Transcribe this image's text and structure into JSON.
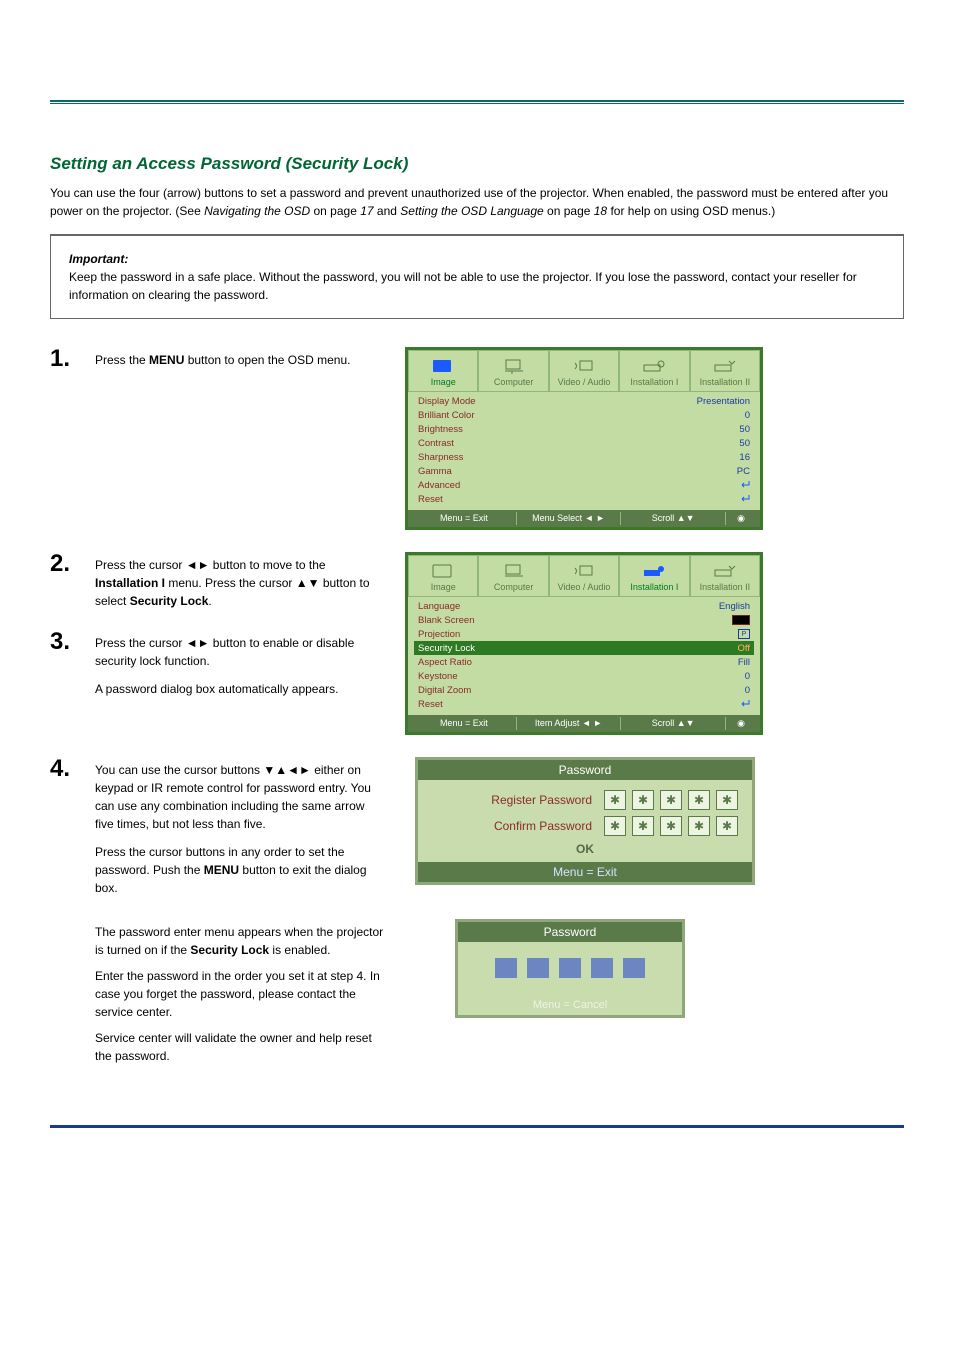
{
  "section_title": "Setting an Access Password (Security Lock)",
  "lead": {
    "p1": "You can use the four (arrow) buttons to set a password and prevent unauthorized use of the projector. When enabled, the password must be entered after you power on the projector. (See ",
    "ref1": "Navigating the OSD",
    "p2": " on page ",
    "page1": "17",
    "p3": " and ",
    "ref2": "Setting the OSD Language",
    "p4": " on page ",
    "page2": "18",
    "p5": " for help on using OSD menus.)"
  },
  "note": {
    "head": "Important:",
    "body": "Keep the password in a safe place. Without the password, you will not be able to use the projector. If you lose the password, contact your reseller for information on clearing the password."
  },
  "steps": {
    "s1": {
      "num": "1.",
      "text_a": "Press the ",
      "text_b": " button to open the OSD menu.",
      "key": "MENU"
    },
    "s2": {
      "num": "2.",
      "text_a": "Press the cursor ",
      "text_b": " button to move to the ",
      "text_c": " menu. Press the cursor ",
      "text_d": " button to select ",
      "key1": "◄►",
      "menu": "Installation I",
      "key2": "▲▼",
      "item": "Security Lock"
    },
    "s3": {
      "num": "3.",
      "text_a": "Press the cursor ",
      "text_b": " button to enable or disable security lock function.",
      "key": "◄►",
      "text_c": "A password dialog box automatically appears."
    },
    "s4": {
      "num": "4.",
      "text_a": "You can use the cursor buttons ",
      "key": "▼▲◄►",
      "text_b": " either on keypad or IR remote control for password entry. You can use any combination including the same arrow five times, but not less than five.",
      "text_c": "Press the cursor buttons in any order to set the password. Push the ",
      "key2": "MENU",
      "text_d": " button to exit the dialog box."
    }
  },
  "osd1": {
    "tabs": {
      "image": "Image",
      "computer": "Computer",
      "video": "Video / Audio",
      "inst1": "Installation I",
      "inst2": "Installation II"
    },
    "rows": {
      "display_mode": {
        "label": "Display Mode",
        "val": "Presentation"
      },
      "brilliant_color": {
        "label": "Brilliant Color",
        "val": "0"
      },
      "brightness": {
        "label": "Brightness",
        "val": "50"
      },
      "contrast": {
        "label": "Contrast",
        "val": "50"
      },
      "sharpness": {
        "label": "Sharpness",
        "val": "16"
      },
      "gamma": {
        "label": "Gamma",
        "val": "PC"
      },
      "advanced": {
        "label": "Advanced"
      },
      "reset": {
        "label": "Reset"
      }
    },
    "foot": {
      "exit": "Menu = Exit",
      "select": "Menu Select ◄ ►",
      "scroll": "Scroll ▲▼"
    }
  },
  "osd2": {
    "tabs": {
      "image": "Image",
      "computer": "Computer",
      "video": "Video / Audio",
      "inst1": "Installation I",
      "inst2": "Installation II"
    },
    "rows": {
      "language": {
        "label": "Language",
        "val": "English"
      },
      "blank_screen": {
        "label": "Blank Screen"
      },
      "projection": {
        "label": "Projection",
        "val": "P"
      },
      "security_lock": {
        "label": "Security Lock",
        "val": "Off"
      },
      "aspect_ratio": {
        "label": "Aspect Ratio",
        "val": "Fill"
      },
      "keystone": {
        "label": "Keystone",
        "val": "0"
      },
      "digital_zoom": {
        "label": "Digital Zoom",
        "val": "0"
      },
      "reset": {
        "label": "Reset"
      }
    },
    "foot": {
      "exit": "Menu = Exit",
      "adjust": "Item Adjust ◄ ►",
      "scroll": "Scroll ▲▼"
    }
  },
  "pwd_dialog": {
    "title": "Password",
    "register": "Register Password",
    "confirm": "Confirm Password",
    "star": "✱",
    "ok": "OK",
    "foot": "Menu = Exit"
  },
  "para5": "The password enter menu appears when the projector is turned on if the ",
  "para5b": "Security Lock",
  "para5c": " is enabled.",
  "para6": "Enter the password in the order you set it at step 4. In case you forget the password, please contact the service center.",
  "para7": "Service center will validate the owner and help reset the password.",
  "pwd_small": {
    "title": "Password",
    "foot": "Menu = Cancel"
  }
}
